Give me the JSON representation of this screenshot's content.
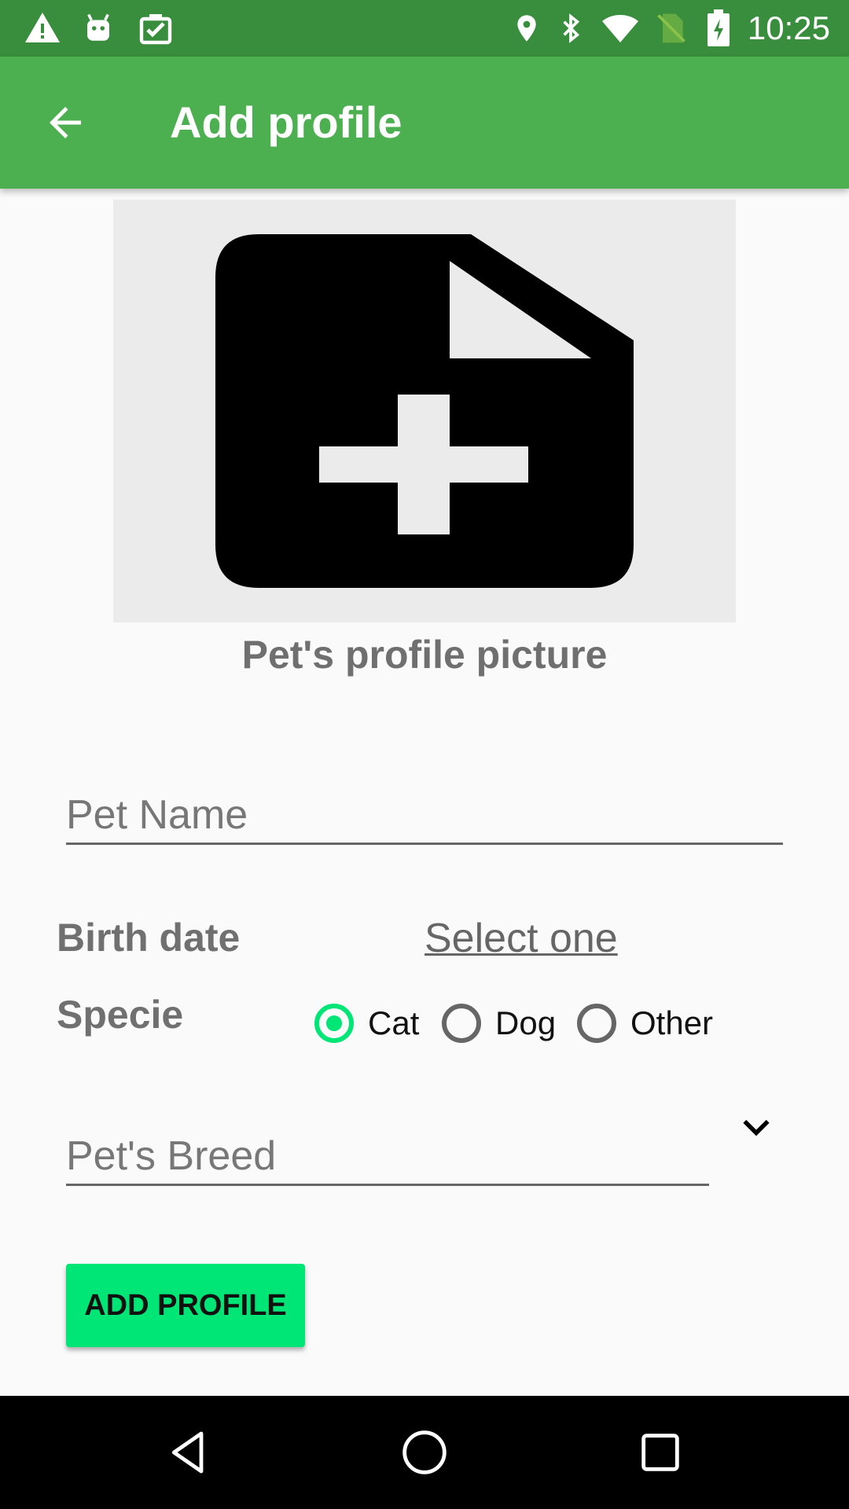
{
  "status_bar": {
    "time": "10:25",
    "left_icons": [
      "warning-icon",
      "android-icon",
      "clipboard-check-icon"
    ],
    "right_icons": [
      "location-pin-icon",
      "bluetooth-icon",
      "wifi-icon",
      "no-sim-icon",
      "battery-charging-icon"
    ]
  },
  "app_bar": {
    "title": "Add profile",
    "back_icon": "arrow-back-icon",
    "color": "#4caf50"
  },
  "picture": {
    "icon": "add-file-icon",
    "caption": "Pet's profile picture"
  },
  "form": {
    "pet_name": {
      "placeholder": "Pet Name",
      "value": ""
    },
    "birth_date": {
      "label": "Birth date",
      "value": "Select one"
    },
    "specie": {
      "label": "Specie",
      "options": [
        "Cat",
        "Dog",
        "Other"
      ],
      "selected": "Cat"
    },
    "breed": {
      "placeholder": "Pet's Breed",
      "value": "",
      "icon": "chevron-down-icon"
    },
    "submit_label": "ADD PROFILE",
    "accent_color": "#00e676"
  },
  "nav_bar": {
    "icons": [
      "nav-back-icon",
      "nav-home-icon",
      "nav-recents-icon"
    ]
  }
}
